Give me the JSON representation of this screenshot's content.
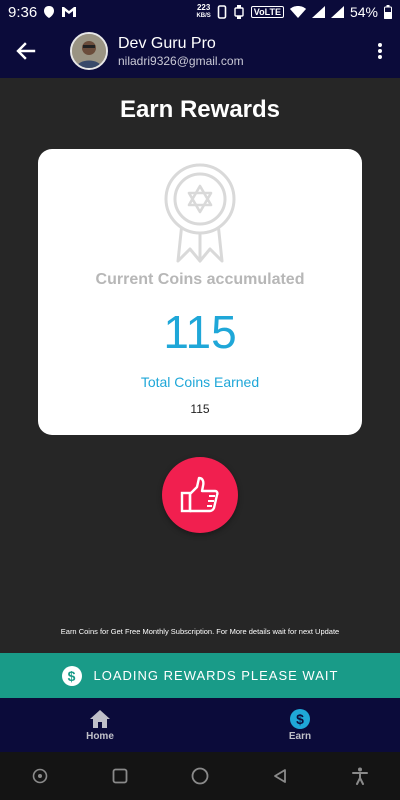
{
  "status_bar": {
    "time": "9:36",
    "net_speed_value": "223",
    "net_speed_unit": "KB/S",
    "network_label": "VoLTE",
    "battery": "54%"
  },
  "header": {
    "user_name": "Dev Guru Pro",
    "user_email": "niladri9326@gmail.com"
  },
  "page": {
    "title": "Earn Rewards"
  },
  "card": {
    "coins_label": "Current Coins accumulated",
    "coins_value": "115",
    "total_label": "Total Coins Earned",
    "total_value": "115"
  },
  "info_note": "Earn Coins for Get Free Monthly Subscription. For More details wait for next Update",
  "loading_bar": {
    "text": "LOADING REWARDS PLEASE WAIT"
  },
  "bottom_nav": {
    "items": [
      {
        "label": "Home",
        "icon": "home-icon"
      },
      {
        "label": "Earn",
        "icon": "dollar-icon"
      }
    ]
  },
  "colors": {
    "appbar": "#0b0b3a",
    "accent": "#1fa7d8",
    "like": "#f11f4f",
    "loading": "#199b88",
    "background": "#262626"
  }
}
